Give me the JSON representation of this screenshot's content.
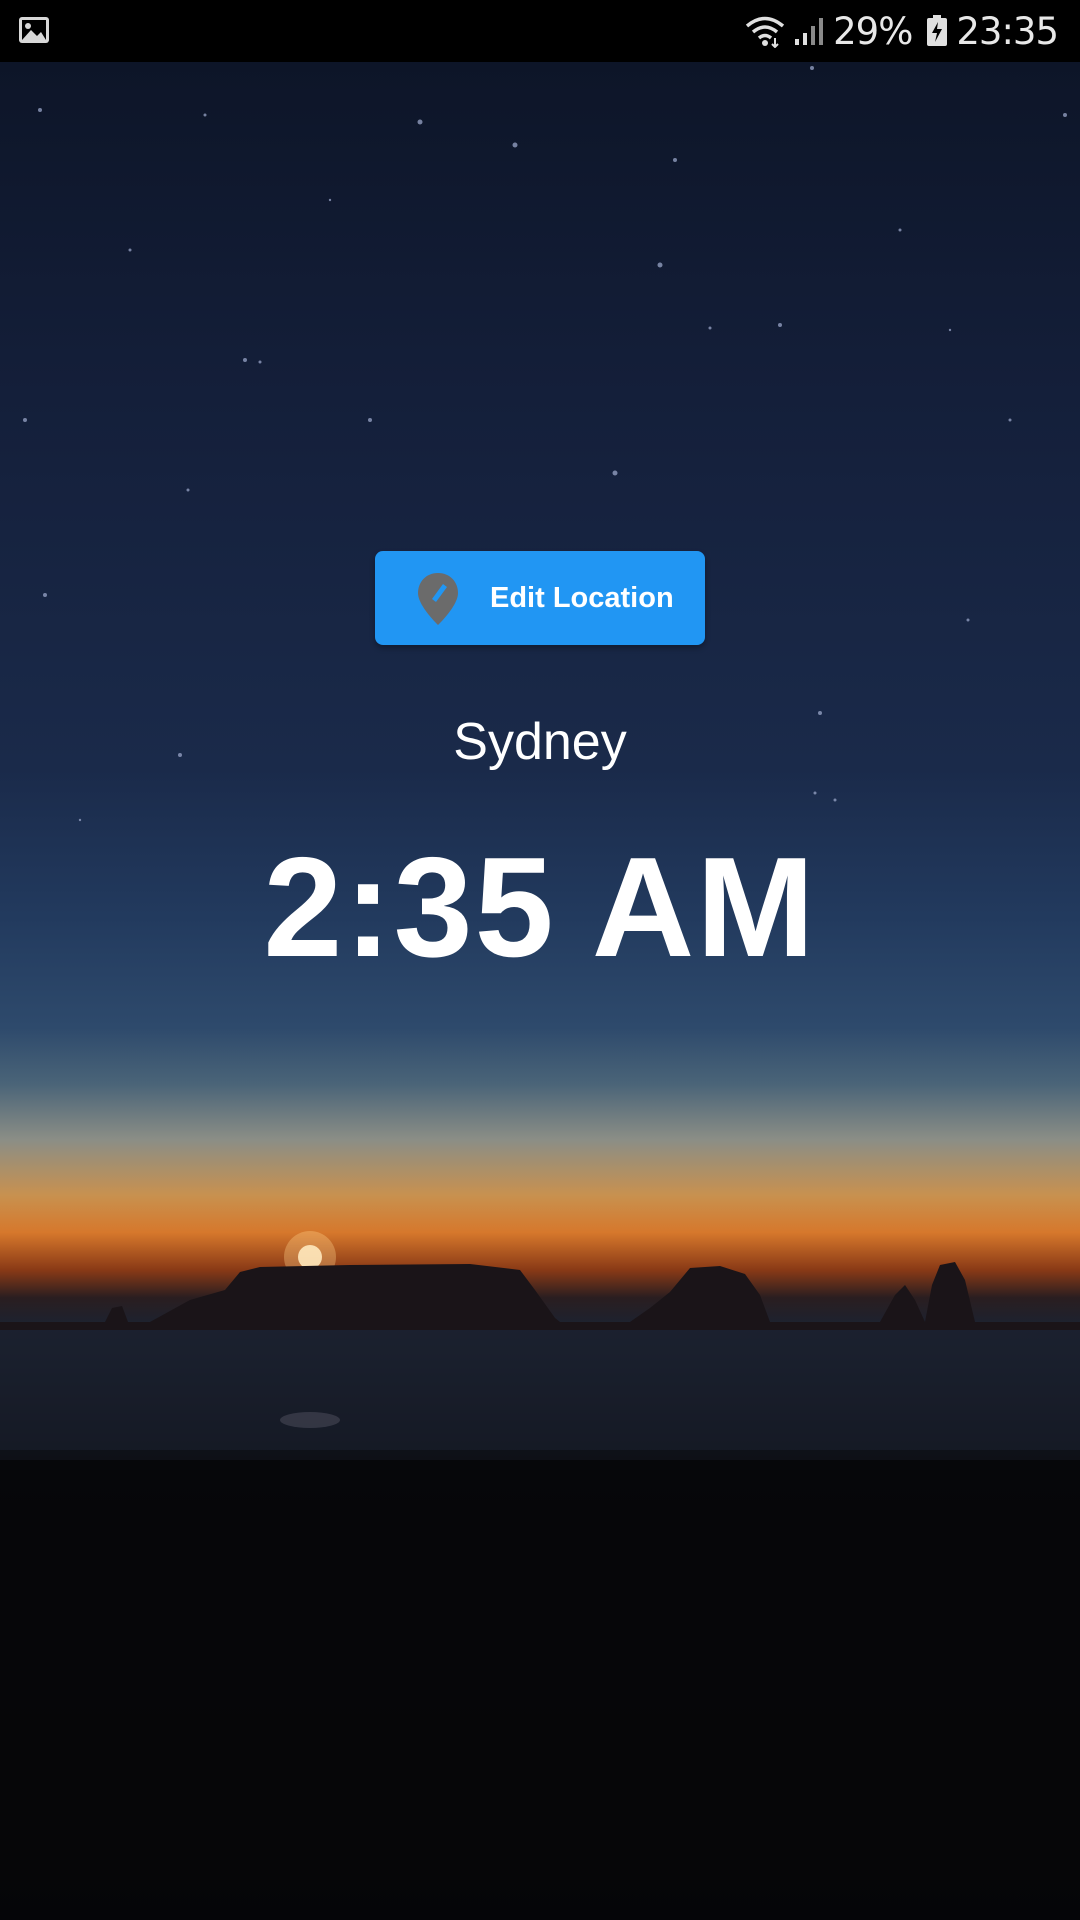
{
  "status_bar": {
    "notification_icon": "gallery-icon",
    "battery_percent": "29%",
    "clock": "23:35",
    "icons": [
      "wifi-icon",
      "signal-icon",
      "battery-charging-icon"
    ]
  },
  "location_button": {
    "label": "Edit Location",
    "icon": "location-pin-icon",
    "color": "#2196f3"
  },
  "location": {
    "city": "Sydney",
    "time": "2:35 AM"
  },
  "background": {
    "description_icon": "night-sky-coast-image"
  }
}
